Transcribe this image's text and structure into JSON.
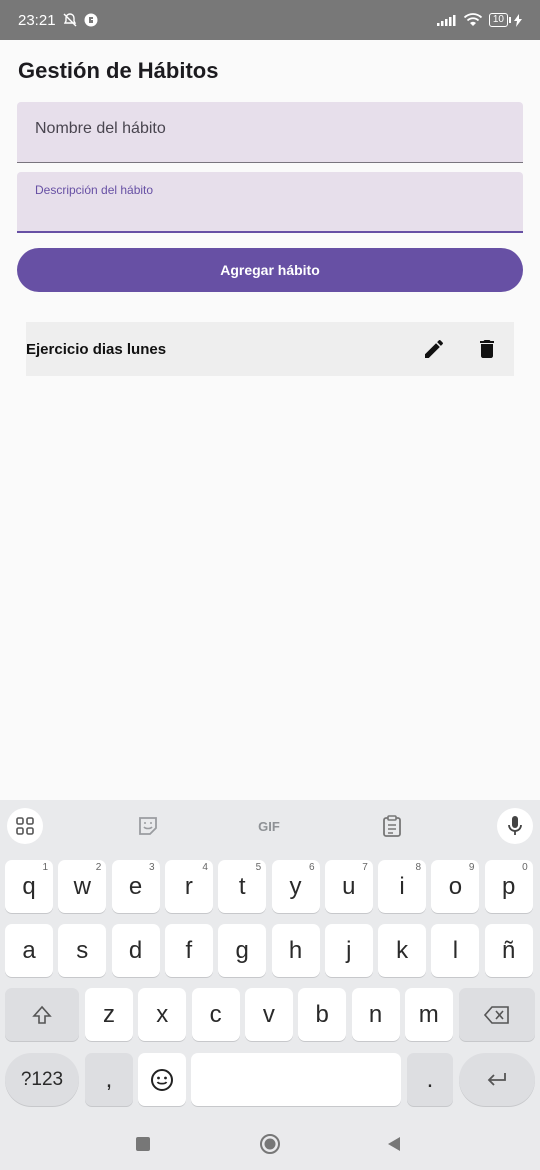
{
  "status": {
    "time": "23:21",
    "battery": "10"
  },
  "app": {
    "title": "Gestión de Hábitos",
    "name_placeholder": "Nombre del hábito",
    "description_label": "Descripción del hábito",
    "add_button": "Agregar hábito"
  },
  "habits": [
    {
      "name": "Ejercicio dias lunes"
    }
  ],
  "keyboard": {
    "gif_label": "GIF",
    "row1": [
      {
        "k": "q",
        "n": "1"
      },
      {
        "k": "w",
        "n": "2"
      },
      {
        "k": "e",
        "n": "3"
      },
      {
        "k": "r",
        "n": "4"
      },
      {
        "k": "t",
        "n": "5"
      },
      {
        "k": "y",
        "n": "6"
      },
      {
        "k": "u",
        "n": "7"
      },
      {
        "k": "i",
        "n": "8"
      },
      {
        "k": "o",
        "n": "9"
      },
      {
        "k": "p",
        "n": "0"
      }
    ],
    "row2": [
      "a",
      "s",
      "d",
      "f",
      "g",
      "h",
      "j",
      "k",
      "l",
      "ñ"
    ],
    "row3": [
      "z",
      "x",
      "c",
      "v",
      "b",
      "n",
      "m"
    ],
    "numbers_key": "?123",
    "comma": ",",
    "period": "."
  },
  "colors": {
    "accent": "#6750a4",
    "field_bg": "#e7dfeb"
  }
}
